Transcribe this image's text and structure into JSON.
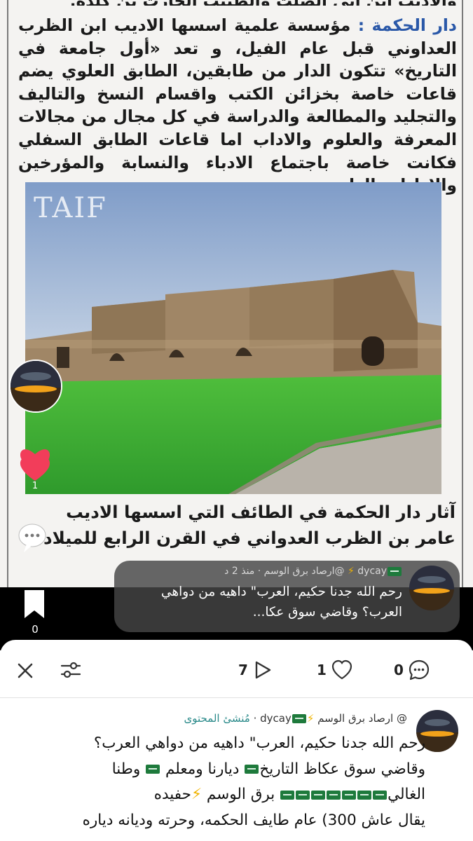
{
  "article": {
    "top_line": "والاديب ابن ابي الصلت والطبيب الحارث بن كلدة.",
    "keyword": "دار الحكمة :",
    "body": "مؤسسة علمية اسسها الاديب ابن الظرب العداوني قبل عام الفيل، و تعد «أول جامعة في التاريخ» تتكون الدار من طابقين، الطابق العلوي يضم قاعات خاصة بخزائن الكتب واقسام النسخ والتاليف والتجليد والمطالعة والدراسة في كل مجال من مجالات المعرفة والعلوم والاداب اما قاعات الطابق السفلي فكانت خاصة باجتماع الادباء والنسابة والمؤرخين والاطباء والدارسين.",
    "photo_watermark": "TAIF",
    "caption": "آثار دار الحكمة في الطائف التي اسسها الاديب عامر بن الظرب العدواني في القرن الرابع للميلاد"
  },
  "overlay": {
    "like_count": "1",
    "bookmark_count": "0"
  },
  "toast": {
    "username": "dycay",
    "handle": "@ارصاد برق الوسم",
    "time": "منذ 2 د",
    "text": "رحم الله جدنا حكيم، العرب\" داهيه من دواهي العرب؟ وقاضي سوق عكا..."
  },
  "toolbar": {
    "share_count": "7",
    "like_count": "1",
    "comment_count": "0"
  },
  "comment": {
    "username": "dycay",
    "handle": "@ ارصاد برق الوسم",
    "role": "مُنشئ المحتوى",
    "line1": "رحم الله جدنا حكيم، العرب\" داهيه من دواهي العرب؟",
    "line2a": "وقاضي سوق عكاظ التاريخ",
    "line2b": "ديارنا ومعلم",
    "line2c": "وطنا",
    "line3a": "الغالي",
    "line3b": "برق الوسم",
    "line3c": "حفيده",
    "line4": "يقال عاش 300) عام طايف الحكمه، وحرته وديانه دياره"
  },
  "colors": {
    "keyword_blue": "#2a58a8",
    "role_teal": "#2a8a8a",
    "flag_green": "#1e7a3c",
    "heart_red": "#f23d5a"
  },
  "icons": [
    "avatar",
    "heart-icon",
    "comment-bubble-icon",
    "bookmark-icon",
    "close-icon",
    "filter-icon",
    "share-arrow-icon",
    "like-heart-icon",
    "comment-icon",
    "flag-icon",
    "lightning-icon"
  ]
}
